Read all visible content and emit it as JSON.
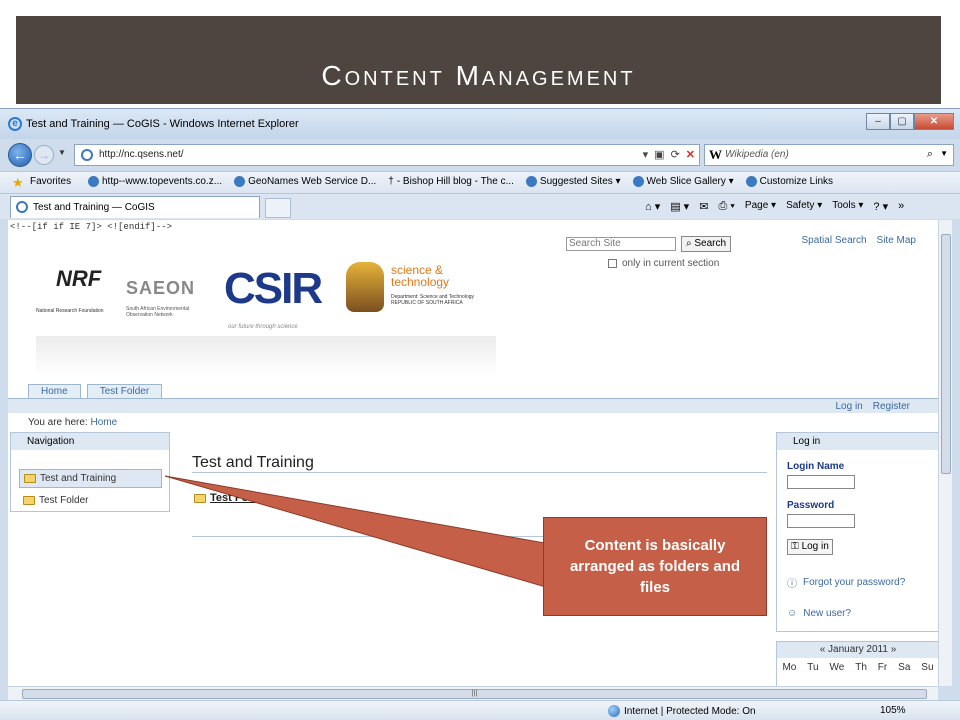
{
  "slide": {
    "title": "Content Management"
  },
  "browser": {
    "window_title": "Test and Training — CoGIS - Windows Internet Explorer",
    "url": "http://nc.qsens.net/",
    "search_placeholder": "Wikipedia (en)",
    "favorites_label": "Favorites",
    "favorites": [
      "http--www.topevents.co.z...",
      "GeoNames Web Service D...",
      "- Bishop Hill blog - The c...",
      "Suggested Sites ▾",
      "Web Slice Gallery ▾",
      "Customize Links"
    ],
    "tab_label": "Test and Training — CoGIS",
    "commands": {
      "page": "Page ▾",
      "safety": "Safety ▾",
      "tools": "Tools ▾"
    },
    "status": {
      "zone": "Internet | Protected Mode: On",
      "zoom": "105%"
    }
  },
  "site": {
    "ie_comment": "<!--[if if IE 7]> <![endif]-->",
    "search_placeholder": "Search Site",
    "search_button": "Search",
    "only_current": "only in current section",
    "top_links": [
      "Spatial Search",
      "Site Map"
    ],
    "logos": {
      "nrf": "NRF",
      "nrf_sub": "National Research Foundation",
      "saeon": "SAEON",
      "saeon_sub": "South African Environmental Observation Network",
      "csir": "CSIR",
      "csir_sub": "our future through science",
      "dst": "science & technology",
      "dst_sub": "Department: Science and Technology REPUBLIC OF SOUTH AFRICA"
    },
    "tabs": [
      "Home",
      "Test Folder"
    ],
    "account_links": [
      "Log in",
      "Register"
    ],
    "breadcrumb_prefix": "You are here:",
    "breadcrumb_home": "Home",
    "navigation": {
      "title": "Navigation",
      "items": [
        "Test and Training",
        "Test Folder"
      ]
    },
    "content": {
      "title": "Test and Training",
      "folder": "Test Folder"
    },
    "login": {
      "title": "Log in",
      "login_name": "Login Name",
      "password": "Password",
      "button": "Log in",
      "forgot": "Forgot your password?",
      "new_user": "New user?"
    },
    "calendar": {
      "month": "« January 2011 »",
      "days": [
        "Mo",
        "Tu",
        "We",
        "Th",
        "Fr",
        "Sa",
        "Su"
      ]
    }
  },
  "callout": {
    "text": "Content is basically arranged as folders and files"
  },
  "colors": {
    "title_bg": "#4f4540",
    "callout_bg": "#c55f47"
  }
}
